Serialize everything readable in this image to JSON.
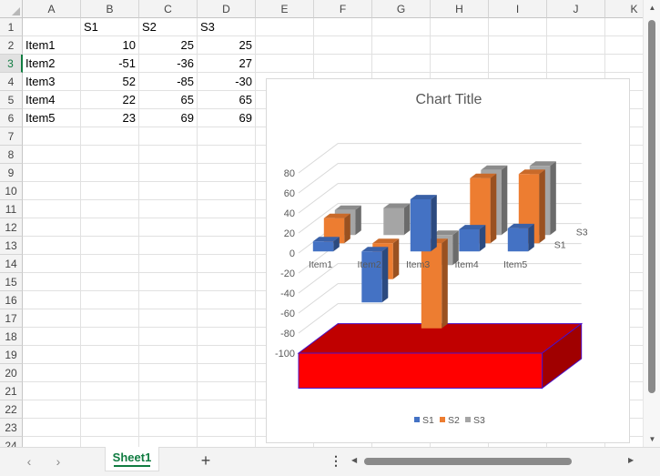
{
  "columns": [
    "A",
    "B",
    "C",
    "D",
    "E",
    "F",
    "G",
    "H",
    "I",
    "J",
    "K"
  ],
  "rows": [
    "1",
    "2",
    "3",
    "4",
    "5",
    "6",
    "7",
    "8",
    "9",
    "10",
    "11",
    "12",
    "13",
    "14",
    "15",
    "16",
    "17",
    "18",
    "19",
    "20",
    "21",
    "22",
    "23",
    "24"
  ],
  "cells": [
    {
      "col": 1,
      "row": 0,
      "v": "S1",
      "t": "s"
    },
    {
      "col": 2,
      "row": 0,
      "v": "S2",
      "t": "s"
    },
    {
      "col": 3,
      "row": 0,
      "v": "S3",
      "t": "s"
    },
    {
      "col": 0,
      "row": 1,
      "v": "Item1",
      "t": "s"
    },
    {
      "col": 1,
      "row": 1,
      "v": "10",
      "t": "n"
    },
    {
      "col": 2,
      "row": 1,
      "v": "25",
      "t": "n"
    },
    {
      "col": 3,
      "row": 1,
      "v": "25",
      "t": "n"
    },
    {
      "col": 0,
      "row": 2,
      "v": "Item2",
      "t": "s"
    },
    {
      "col": 1,
      "row": 2,
      "v": "-51",
      "t": "n"
    },
    {
      "col": 2,
      "row": 2,
      "v": "-36",
      "t": "n"
    },
    {
      "col": 3,
      "row": 2,
      "v": "27",
      "t": "n"
    },
    {
      "col": 0,
      "row": 3,
      "v": "Item3",
      "t": "s"
    },
    {
      "col": 1,
      "row": 3,
      "v": "52",
      "t": "n"
    },
    {
      "col": 2,
      "row": 3,
      "v": "-85",
      "t": "n"
    },
    {
      "col": 3,
      "row": 3,
      "v": "-30",
      "t": "n"
    },
    {
      "col": 0,
      "row": 4,
      "v": "Item4",
      "t": "s"
    },
    {
      "col": 1,
      "row": 4,
      "v": "22",
      "t": "n"
    },
    {
      "col": 2,
      "row": 4,
      "v": "65",
      "t": "n"
    },
    {
      "col": 3,
      "row": 4,
      "v": "65",
      "t": "n"
    },
    {
      "col": 0,
      "row": 5,
      "v": "Item5",
      "t": "s"
    },
    {
      "col": 1,
      "row": 5,
      "v": "23",
      "t": "n"
    },
    {
      "col": 2,
      "row": 5,
      "v": "69",
      "t": "n"
    },
    {
      "col": 3,
      "row": 5,
      "v": "69",
      "t": "n"
    }
  ],
  "selected_row": "3",
  "sheet_tab": "Sheet1",
  "add_sheet": "+",
  "menu_dots": "⋮",
  "nav": {
    "prev": "‹",
    "next": "›"
  },
  "chart_data": {
    "type": "bar",
    "title": "Chart Title",
    "categories": [
      "Item1",
      "Item2",
      "Item3",
      "Item4",
      "Item5"
    ],
    "series": [
      {
        "name": "S1",
        "values": [
          10,
          -51,
          52,
          22,
          23
        ],
        "color": "#4472c4"
      },
      {
        "name": "S2",
        "values": [
          25,
          -36,
          -85,
          65,
          69
        ],
        "color": "#ed7d31"
      },
      {
        "name": "S3",
        "values": [
          25,
          27,
          -30,
          65,
          69
        ],
        "color": "#a5a5a5"
      }
    ],
    "depth_labels": [
      "S1",
      "S3"
    ],
    "y_ticks": [
      "80",
      "60",
      "40",
      "20",
      "0",
      "-20",
      "-40",
      "-60",
      "-80",
      "-100"
    ],
    "ylim": [
      -100,
      80
    ],
    "floor_color": "#ff0000",
    "floor_edge_color": "#4b0fc8",
    "legend_position": "bottom",
    "gridlines": true
  }
}
